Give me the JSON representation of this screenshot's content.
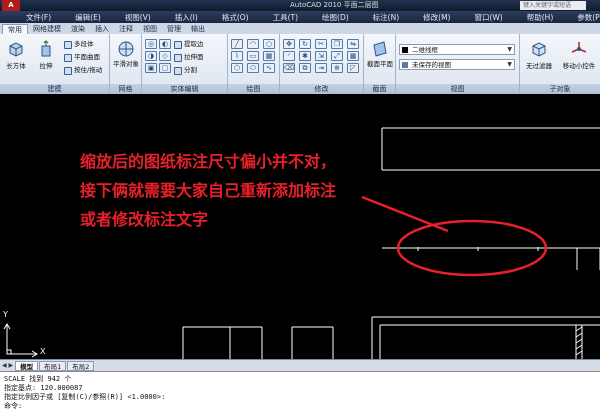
{
  "titlebar": {
    "logo": "A",
    "title": "AutoCAD 2010    平面二层图",
    "search_placeholder": "键入关键字或短语"
  },
  "menubar": [
    "文件(F)",
    "编辑(E)",
    "视图(V)",
    "插入(I)",
    "格式(O)",
    "工具(T)",
    "绘图(D)",
    "标注(N)",
    "修改(M)",
    "窗口(W)",
    "帮助(H)",
    "参数(P)"
  ],
  "ribbon_tabs": [
    "常用",
    "网格建模",
    "渲染",
    "插入",
    "注释",
    "视图",
    "管理",
    "输出"
  ],
  "ribbon": {
    "modeling": {
      "title": "建模",
      "big": [
        "长方体",
        "拉伸"
      ],
      "small": [
        "多段体",
        "平面曲面",
        "按住/拖动"
      ]
    },
    "mesh": {
      "title": "网格",
      "big": [
        "平滑对象"
      ]
    },
    "solid_edit": {
      "title": "实体编辑",
      "small": [
        "提取边",
        "拉伸面",
        "分割"
      ]
    },
    "draw": {
      "title": "绘图"
    },
    "modify": {
      "title": "修改"
    },
    "section": {
      "title": "截面",
      "big": [
        "截面平面"
      ]
    },
    "view": {
      "title": "视图",
      "visual_style": "二维线框",
      "named_view": "未保存的视图"
    },
    "subobject": {
      "title": "子对象",
      "big": [
        "无过滤器",
        "移动小控件"
      ]
    }
  },
  "annotation": [
    "缩放后的图纸标注尺寸偏小并不对，",
    "接下俩就需要大家自己重新添加标注",
    "或者修改标注文字"
  ],
  "ucs": {
    "x": "X",
    "y": "Y"
  },
  "layout_tabs": {
    "nav": "◀ ▶",
    "tabs": [
      "模型",
      "布局1",
      "布局2"
    ],
    "active": 0
  },
  "command_history": [
    "SCALE 找到 942 个",
    "指定基点: 120.000087",
    "指定比例因子或 [复制(C)/参照(R)] <1.0000>:",
    "命令:"
  ],
  "colors": {
    "annotation": "#e8202a",
    "canvas": "#000000",
    "lines": "#ffffff"
  }
}
